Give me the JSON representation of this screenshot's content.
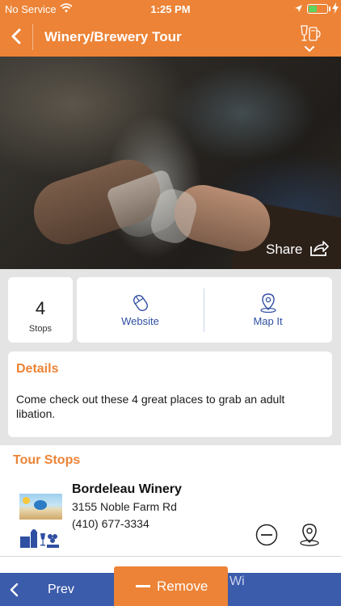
{
  "status_bar": {
    "carrier": "No Service",
    "time": "1:25 PM",
    "battery_level": 0.45,
    "battery_color": "#5fd35d"
  },
  "nav": {
    "title": "Winery/Brewery Tour",
    "back_icon": "chevron-left-icon",
    "filter_icon": "drinks-filter-icon"
  },
  "hero": {
    "share_label": "Share",
    "share_icon": "share-icon"
  },
  "summary": {
    "stops_count": "4",
    "stops_label": "Stops",
    "website_label": "Website",
    "website_icon": "mouse-icon",
    "mapit_label": "Map It",
    "mapit_icon": "map-pin-icon"
  },
  "details": {
    "heading": "Details",
    "body": "Come check out these 4 great places to grab an adult libation."
  },
  "tour_stops": {
    "heading": "Tour Stops",
    "items": [
      {
        "name": "Bordeleau Winery",
        "address": "3155 Noble Farm Rd",
        "phone": "(410) 677-3334",
        "category_icon": "winery-icon",
        "remove_icon": "remove-circle-icon",
        "map_icon": "map-pin-icon"
      }
    ]
  },
  "bottom_bar": {
    "prev_label": "Prev",
    "remove_label": "Remove",
    "partial_text": "Wi"
  },
  "colors": {
    "brand_orange": "#ec8336",
    "brand_blue": "#3b5bab",
    "link_blue": "#2f4fa2"
  }
}
